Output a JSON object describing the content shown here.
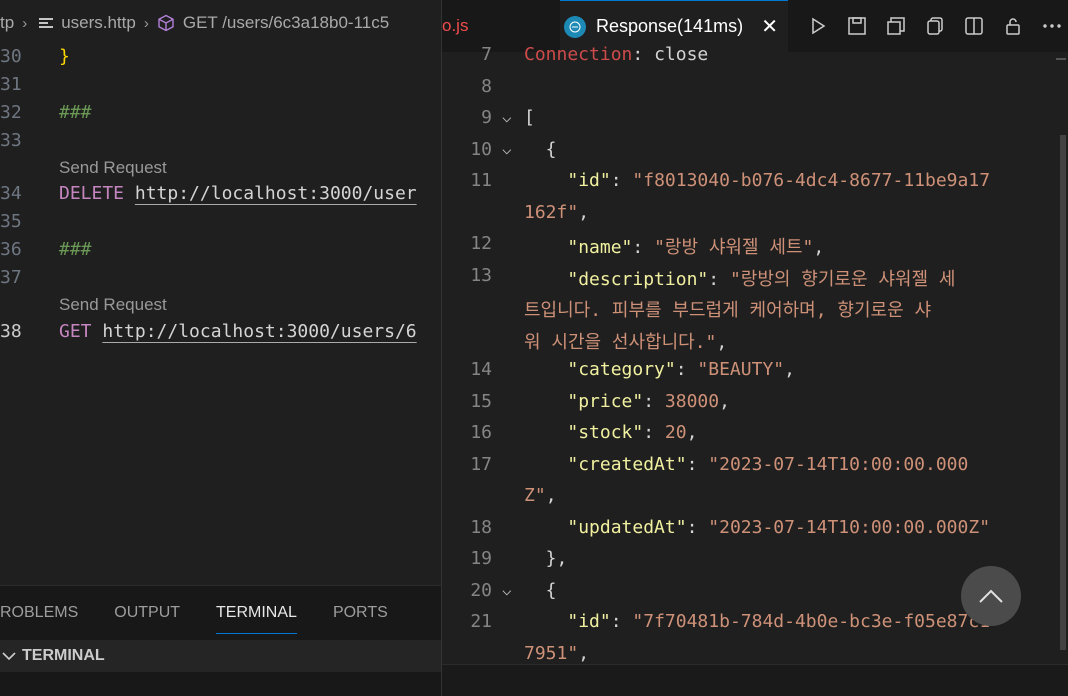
{
  "left_editor": {
    "breadcrumb": {
      "folder": "tp",
      "file": "users.http",
      "request": "GET /users/6c3a18b0-11c5"
    },
    "lines": [
      {
        "num": "30",
        "text": "}"
      },
      {
        "num": "31",
        "text": ""
      },
      {
        "num": "32",
        "text": "###"
      },
      {
        "num": "33",
        "text": ""
      },
      {
        "codelens": "Send Request"
      },
      {
        "num": "34",
        "method": "DELETE",
        "url": "http://localhost:3000/user"
      },
      {
        "num": "35",
        "text": ""
      },
      {
        "num": "36",
        "text": "###"
      },
      {
        "num": "37",
        "text": ""
      },
      {
        "codelens": "Send Request"
      },
      {
        "num": "38",
        "method": "GET",
        "url": "http://localhost:3000/users/6"
      }
    ]
  },
  "panel": {
    "tabs": [
      "ROBLEMS",
      "OUTPUT",
      "TERMINAL",
      "PORTS"
    ],
    "active_tab": "TERMINAL",
    "section_title": "TERMINAL"
  },
  "right_panel": {
    "prev_tab_label": "o.js",
    "response_tab": "Response(141ms)",
    "close_glyph": "✕",
    "lines": {
      "l7": {
        "num": "7",
        "key": "Connection",
        "sep": ": ",
        "val": "close"
      },
      "l8": {
        "num": "8"
      },
      "l9": {
        "num": "9",
        "text": "["
      },
      "l10": {
        "num": "10",
        "text": "  {"
      },
      "l11": {
        "num": "11",
        "key": "\"id\"",
        "val": "\"f8013040-b076-4dc4-8677-11be9a17"
      },
      "l11b": {
        "val": "162f\"",
        "tail": ","
      },
      "l12": {
        "num": "12",
        "key": "\"name\"",
        "val": "\"랑방 샤워젤 세트\"",
        "tail": ","
      },
      "l13": {
        "num": "13",
        "key": "\"description\"",
        "val": "\"랑방의 향기로운 샤워젤 세"
      },
      "l13b": {
        "val": "트입니다. 피부를 부드럽게 케어하며, 향기로운 샤"
      },
      "l13c": {
        "val": "워 시간을 선사합니다.\"",
        "tail": ","
      },
      "l14": {
        "num": "14",
        "key": "\"category\"",
        "val": "\"BEAUTY\"",
        "tail": ","
      },
      "l15": {
        "num": "15",
        "key": "\"price\"",
        "val": "38000",
        "tail": ","
      },
      "l16": {
        "num": "16",
        "key": "\"stock\"",
        "val": "20",
        "tail": ","
      },
      "l17": {
        "num": "17",
        "key": "\"createdAt\"",
        "val": "\"2023-07-14T10:00:00.000"
      },
      "l17b": {
        "val": "Z\"",
        "tail": ","
      },
      "l18": {
        "num": "18",
        "key": "\"updatedAt\"",
        "val": "\"2023-07-14T10:00:00.000Z\""
      },
      "l19": {
        "num": "19",
        "text": "  },"
      },
      "l20": {
        "num": "20",
        "text": "  {"
      },
      "l21": {
        "num": "21",
        "key": "\"id\"",
        "val": "\"7f70481b-784d-4b0e-bc3e-f05e87c1"
      },
      "l21b": {
        "val": "7951\"",
        "tail": ","
      }
    }
  },
  "colors": {
    "json_key": "#f0f0a0",
    "json_string": "#ce9178",
    "json_number": "#b5cea8",
    "http_method": "#c586c0",
    "accent": "#0078d4"
  }
}
